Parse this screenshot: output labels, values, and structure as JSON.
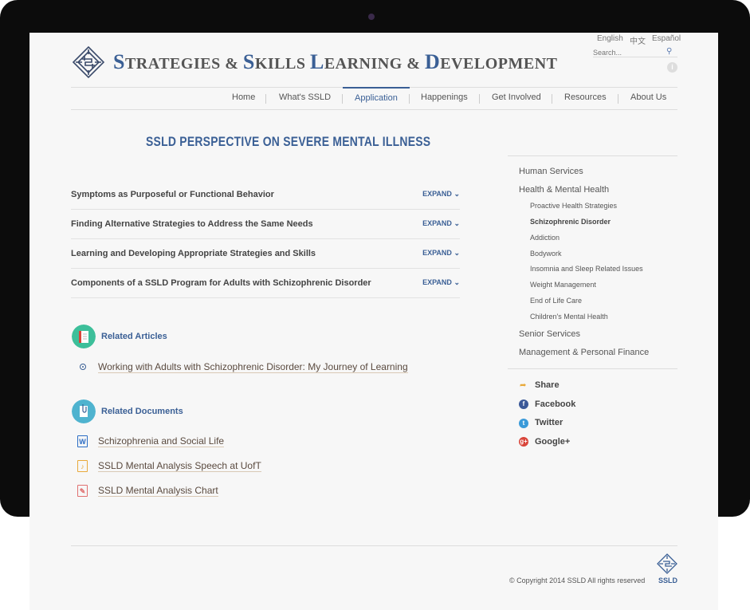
{
  "header": {
    "site_title_parts": [
      {
        "cap": "S",
        "rest": "TRATEGIES & "
      },
      {
        "cap": "S",
        "rest": "KILLS "
      },
      {
        "cap": "L",
        "rest": "EARNING & "
      },
      {
        "cap": "D",
        "rest": "EVELOPMENT"
      }
    ],
    "languages": [
      "English",
      "中文",
      "Español"
    ],
    "search_placeholder": "Search..."
  },
  "nav": {
    "items": [
      "Home",
      "What's SSLD",
      "Application",
      "Happenings",
      "Get Involved",
      "Resources",
      "About Us"
    ],
    "active": "Application"
  },
  "main": {
    "page_title": "SSLD PERSPECTIVE ON SEVERE MENTAL ILLNESS",
    "accordion": [
      {
        "title": "Symptoms as Purposeful or Functional Behavior",
        "action": "EXPAND"
      },
      {
        "title": "Finding Alternative Strategies to Address the Same Needs",
        "action": "EXPAND"
      },
      {
        "title": "Learning and Developing Appropriate Strategies and Skills",
        "action": "EXPAND"
      },
      {
        "title": "Components of a SSLD Program for Adults with Schizophrenic Disorder",
        "action": "EXPAND"
      }
    ],
    "related_articles": {
      "heading": "Related Articles",
      "items": [
        "Working with Adults with Schizophrenic Disorder: My Journey of Learning"
      ]
    },
    "related_documents": {
      "heading": "Related Documents",
      "items": [
        {
          "label": "Schizophrenia and Social Life",
          "type": "word",
          "icon_text": "W",
          "color": "#2b6cc4"
        },
        {
          "label": "SSLD Mental Analysis Speech at UofT",
          "type": "audio",
          "icon_text": "♪",
          "color": "#e8a93a"
        },
        {
          "label": "SSLD Mental Analysis Chart",
          "type": "pdf",
          "icon_text": "✎",
          "color": "#e07070"
        }
      ]
    }
  },
  "sidebar": {
    "sections": [
      {
        "label": "Human Services"
      },
      {
        "label": "Health & Mental Health"
      },
      {
        "label": "Senior Services"
      },
      {
        "label": "Management & Personal Finance"
      }
    ],
    "subitems": [
      "Proactive Health Strategies",
      "Schizophrenic Disorder",
      "Addiction",
      "Bodywork",
      "Insomnia and Sleep Related Issues",
      "Weight Management",
      "End of Life Care",
      "Children's Mental Health"
    ],
    "active_subitem": "Schizophrenic Disorder",
    "share": {
      "label": "Share",
      "networks": [
        {
          "label": "Facebook",
          "color": "#3b5998"
        },
        {
          "label": "Twitter",
          "color": "#3a9ad9"
        },
        {
          "label": "Google+",
          "color": "#d9453a"
        }
      ]
    }
  },
  "footer": {
    "copyright": "© Copyright 2014 SSLD All rights reserved",
    "logo_text": "SSLD"
  },
  "colors": {
    "brand_blue": "#3a5f95",
    "articles_icon_bg": "#3dbf9a",
    "documents_icon_bg": "#4fb3cf"
  }
}
